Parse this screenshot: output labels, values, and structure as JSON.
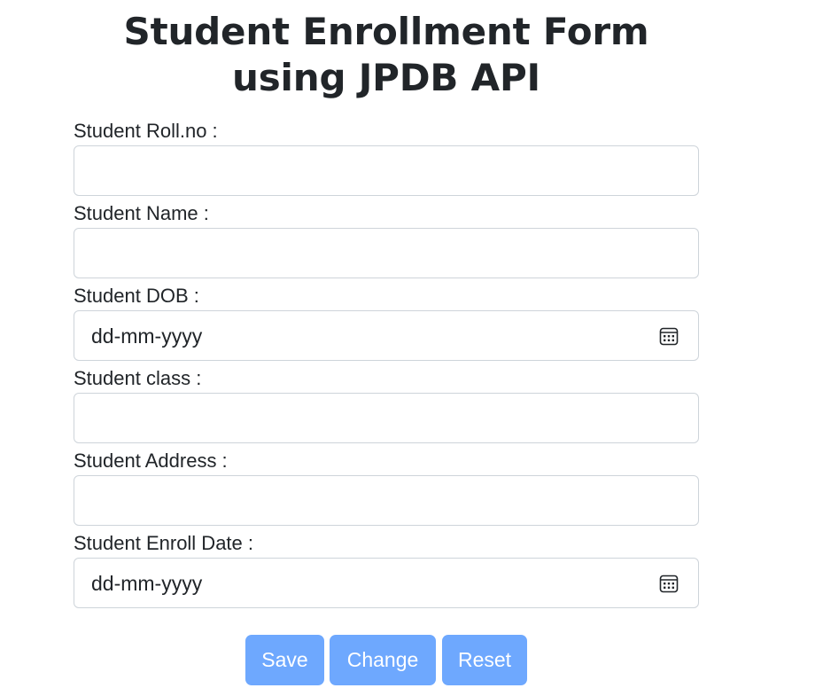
{
  "page": {
    "title": "Student Enrollment Form using JPDB API"
  },
  "form": {
    "roll_no": {
      "label": "Student Roll.no :",
      "value": ""
    },
    "name": {
      "label": "Student Name :",
      "value": ""
    },
    "dob": {
      "label": "Student DOB :",
      "value": "",
      "placeholder": "dd-mm-yyyy"
    },
    "class": {
      "label": "Student class :",
      "value": ""
    },
    "address": {
      "label": "Student Address :",
      "value": ""
    },
    "enroll_date": {
      "label": "Student Enroll Date :",
      "value": "",
      "placeholder": "dd-mm-yyyy"
    }
  },
  "buttons": {
    "save": "Save",
    "change": "Change",
    "reset": "Reset"
  },
  "colors": {
    "button_bg": "#6ea8fe",
    "button_text": "#ffffff",
    "input_border": "#ced4da",
    "text": "#212529"
  },
  "icons": {
    "date_picker": "calendar-icon"
  }
}
